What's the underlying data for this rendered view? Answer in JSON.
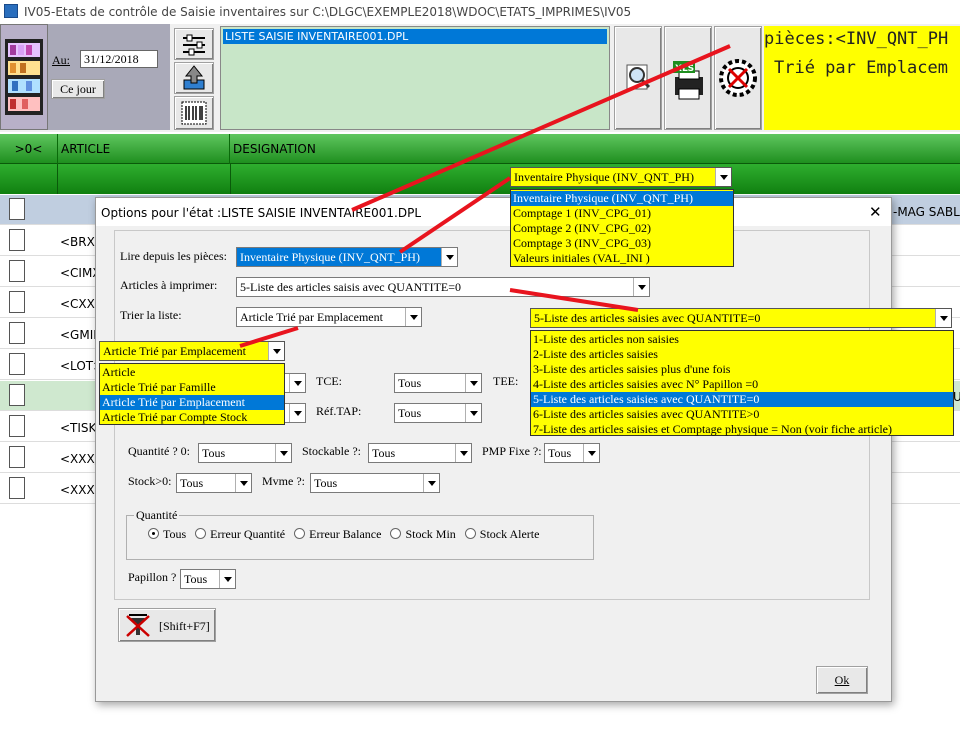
{
  "window": {
    "title": "IV05-Etats de contrôle de Saisie inventaires sur C:\\DLGC\\EXEMPLE2018\\WDOC\\ETATS_IMPRIMES\\IV05"
  },
  "toolbar": {
    "date_label": "Au:",
    "date_value": "31/12/2018",
    "today_button": "Ce jour",
    "file_selected": "LISTE SAISIE INVENTAIRE001.DPL",
    "info_line1": "pièces:<INV_QNT_PH",
    "info_line2": "Trié par Emplacem"
  },
  "grid": {
    "headers": [
      "&gt;0&lt;",
      "ARTICLE",
      "DESIGNATION"
    ],
    "rows": [
      "<BRX/",
      "<CIMX",
      "<CXXX",
      "<GMIN",
      "<LOT>",
      "",
      "<TISK",
      "<XXX/N",
      "<XXXX"
    ],
    "right_fragment": "-MAG SABL",
    "right_fragment2": "U"
  },
  "dialog": {
    "title": "Options pour l'état :LISTE SAISIE INVENTAIRE001.DPL",
    "close": "✕",
    "source_label": "Lire depuis les pièces:",
    "source_value": "Inventaire Physique (INV_QNT_PH)",
    "articles_label": "Articles à imprimer:",
    "articles_value": "5-Liste des articles saisis avec QUANTITE=0",
    "sort_label": "Trier la liste:",
    "sort_value": "Article Trié par Emplacement",
    "tce_label": "TCE:",
    "tce_value": "Tous",
    "tee_label": "TEE:",
    "reftap_label": "Réf.TAP:",
    "reftap_value": "Tous",
    "qty0_label": "Quantité ? 0:",
    "qty0_value": "Tous",
    "stockable_label": "Stockable ?:",
    "stockable_value": "Tous",
    "pmp_label": "PMP Fixe ?:",
    "pmp_value": "Tous",
    "stock0_label": "Stock>0:",
    "stock0_value": "Tous",
    "mvme_label": "Mvme ?:",
    "mvme_value": "Tous",
    "qty_group": "Quantité",
    "radios": [
      "Tous",
      "Erreur Quantité",
      "Erreur Balance",
      "Stock Min",
      "Stock Alerte"
    ],
    "papillon_label": "Papillon ?",
    "papillon_value": "Tous",
    "shift_button": "[Shift+F7]",
    "ok_button": "Ok"
  },
  "dropdown_source": {
    "value": "Inventaire Physique (INV_QNT_PH)",
    "options": [
      "Inventaire Physique (INV_QNT_PH)",
      "Comptage 1 (INV_CPG_01)",
      "Comptage 2 (INV_CPG_02)",
      "Comptage 3 (INV_CPG_03)",
      "Valeurs initiales (VAL_INI )"
    ],
    "selected_index": 0
  },
  "dropdown_sort": {
    "value": "Article Trié par Emplacement",
    "options": [
      "Article",
      "Article Trié par Famille",
      "Article Trié par Emplacement",
      "Article Trié par Compte Stock"
    ],
    "selected_index": 2
  },
  "dropdown_articles": {
    "value": "5-Liste des articles saisies avec QUANTITE=0",
    "options": [
      "1-Liste des articles non saisies",
      "2-Liste des articles saisies",
      "3-Liste des articles saisies plus d'une fois",
      "4-Liste des articles saisies avec N° Papillon =0",
      "5-Liste des articles saisies avec QUANTITE=0",
      "6-Liste des articles saisies avec QUANTITE>0",
      "7-Liste des articles saisies et Comptage physique = Non (voir fiche article)"
    ],
    "selected_index": 4
  },
  "colors": {
    "green_header": "#1f9a1f",
    "yellow": "#ffff00",
    "selection_blue": "#0078d7",
    "annotation_red": "#e8141e",
    "file_panel": "#c8e6c8"
  }
}
